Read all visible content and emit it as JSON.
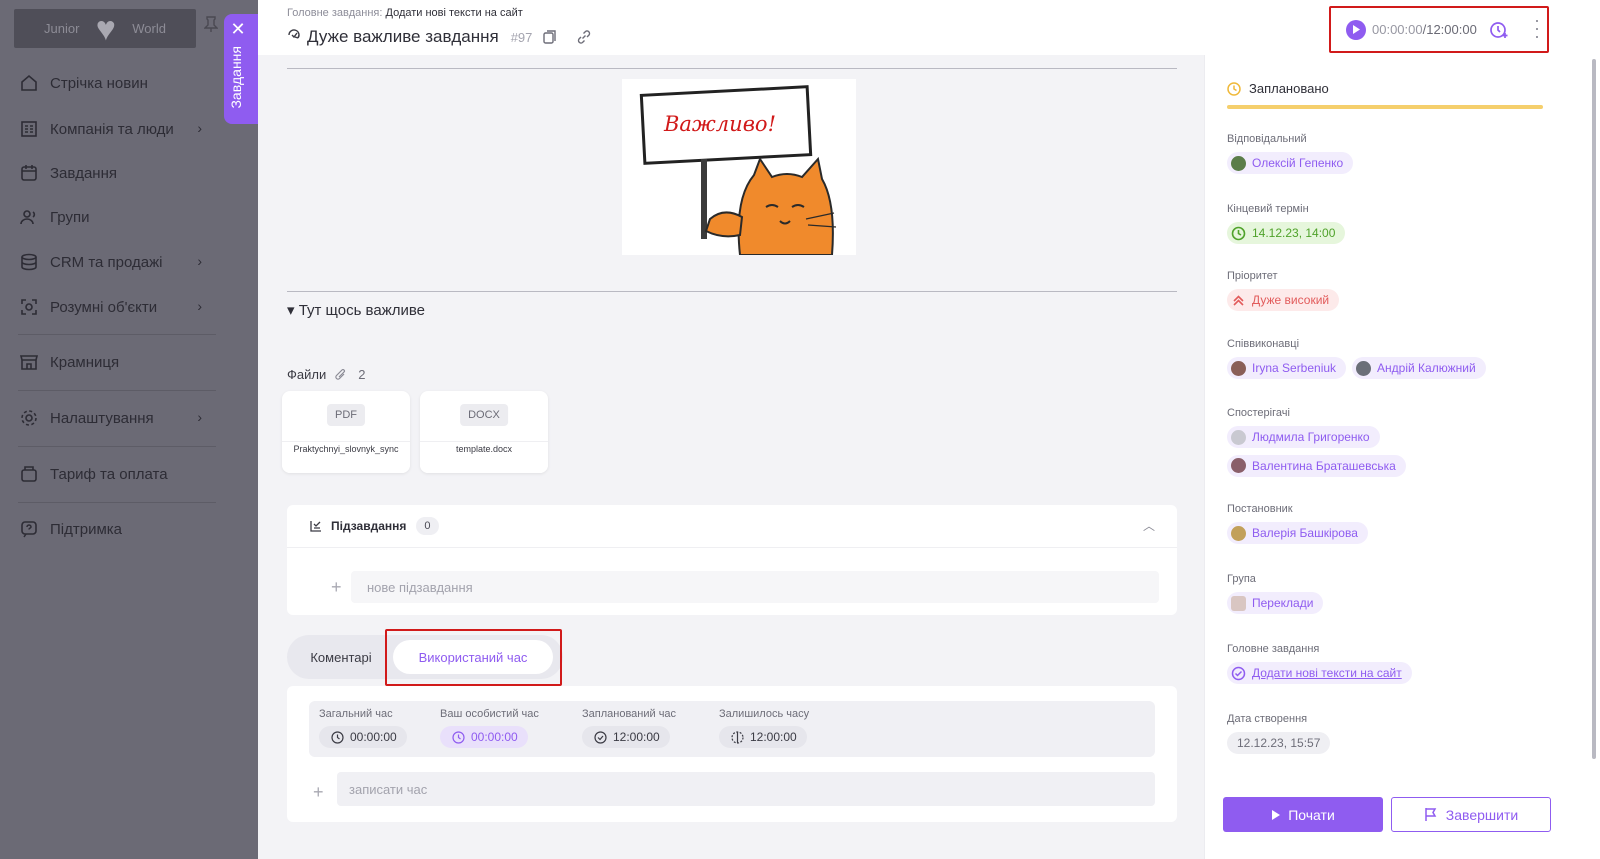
{
  "sidebar": {
    "logo": {
      "left": "Junior",
      "right": "World"
    },
    "items": [
      {
        "label": "Стрічка новин"
      },
      {
        "label": "Компанія та люди"
      },
      {
        "label": "Завдання"
      },
      {
        "label": "Групи"
      },
      {
        "label": "CRM та продажі"
      },
      {
        "label": "Розумні об'єкти"
      },
      {
        "label": "Крамниця"
      },
      {
        "label": "Налаштування"
      },
      {
        "label": "Тариф та оплата"
      },
      {
        "label": "Підтримка"
      }
    ],
    "drawer_tab_label": "Завдання"
  },
  "header": {
    "breadcrumb_prefix": "Головне завдання:",
    "breadcrumb_task": "Додати нові тексти на сайт",
    "title": "Дуже важливе завдання",
    "task_number": "#97",
    "timer_elapsed": "00:00:00",
    "timer_planned": "/12:00:00"
  },
  "description": {
    "image_sign_text": "Важливо!",
    "disclosure": "▾ Тут щось важливе"
  },
  "files": {
    "label": "Файли",
    "count": "2",
    "items": [
      {
        "ext": "PDF",
        "name": "Praktychnyi_slovnyk_sync"
      },
      {
        "ext": "DOCX",
        "name": "template.docx"
      }
    ]
  },
  "subtasks": {
    "label": "Підзавдання",
    "count": "0",
    "placeholder": "нове підзавдання"
  },
  "tabs": {
    "comments": "Коментарі",
    "time_used": "Використаний час"
  },
  "time": {
    "total_label": "Загальний час",
    "total_value": "00:00:00",
    "personal_label": "Ваш особистий час",
    "personal_value": "00:00:00",
    "planned_label": "Запланований час",
    "planned_value": "12:00:00",
    "remaining_label": "Залишилось часу",
    "remaining_value": "12:00:00",
    "placeholder": "записати час"
  },
  "props": {
    "status": "Заплановано",
    "responsible_label": "Відповідальний",
    "responsible": "Олексій Гепенко",
    "deadline_label": "Кінцевий термін",
    "deadline": "14.12.23, 14:00",
    "priority_label": "Пріоритет",
    "priority": "Дуже високий",
    "coexecutors_label": "Співвиконавці",
    "coexecutors": [
      "Iryna Serbeniuk",
      "Андрій Калюжний"
    ],
    "observers_label": "Спостерігачі",
    "observers": [
      "Людмила Григоренко",
      "Валентина Браташевська"
    ],
    "author_label": "Постановник",
    "author": "Валерія Башкірова",
    "group_label": "Група",
    "group": "Переклади",
    "parent_label": "Головне завдання",
    "parent": "Додати нові тексти на сайт",
    "created_label": "Дата створення",
    "created": "12.12.23, 15:57",
    "start_button": "Почати",
    "finish_button": "Завершити"
  },
  "colors": {
    "accent": "#8f5cf0",
    "highlight": "#d11a1a",
    "status": "#f5cf6c"
  }
}
